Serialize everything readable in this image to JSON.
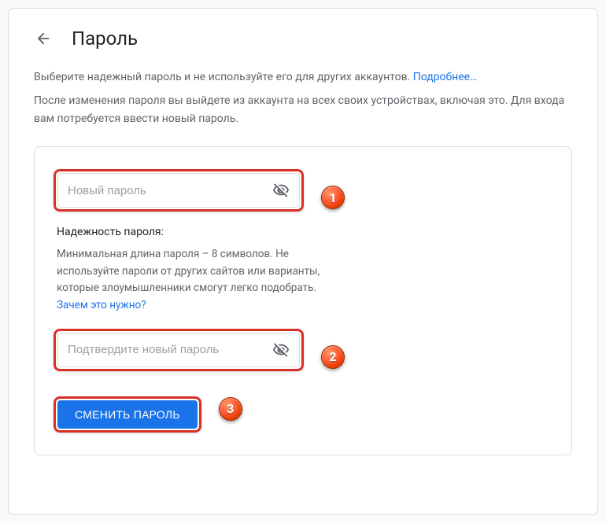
{
  "header": {
    "title": "Пароль"
  },
  "intro": {
    "text": "Выберите надежный пароль и не используйте его для других аккаунтов. ",
    "link": "Подробнее…"
  },
  "desc": "После изменения пароля вы выйдете из аккаунта на всех своих устройствах, включая это. Для входа вам потребуется ввести новый пароль.",
  "fields": {
    "new_password": {
      "placeholder": "Новый пароль"
    },
    "confirm_password": {
      "placeholder": "Подтвердите новый пароль"
    }
  },
  "strength": {
    "title": "Надежность пароля:",
    "text": "Минимальная длина пароля – 8 символов. Не используйте пароли от других сайтов или варианты, которые злоумышленники смогут легко подобрать. ",
    "link": "Зачем это нужно?"
  },
  "submit": {
    "label": "СМЕНИТЬ ПАРОЛЬ"
  },
  "badges": {
    "one": "1",
    "two": "2",
    "three": "3"
  }
}
